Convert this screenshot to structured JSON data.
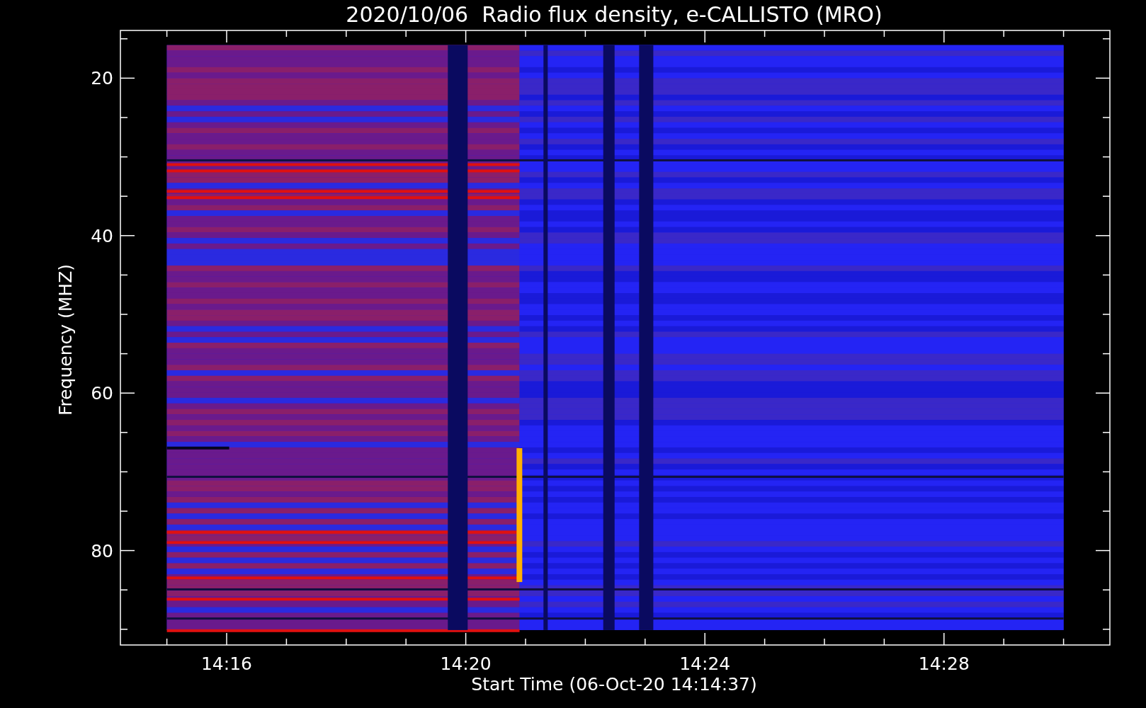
{
  "title": "2020/10/06  Radio flux density, e-CALLISTO (MRO)",
  "y_axis": {
    "label": "Frequency (MHZ)",
    "ticks": [
      "20",
      "40",
      "60",
      "80"
    ]
  },
  "x_axis": {
    "label": "Start Time (06-Oct-20 14:14:37)",
    "ticks": [
      "14:16",
      "14:20",
      "14:24",
      "14:28"
    ]
  }
}
